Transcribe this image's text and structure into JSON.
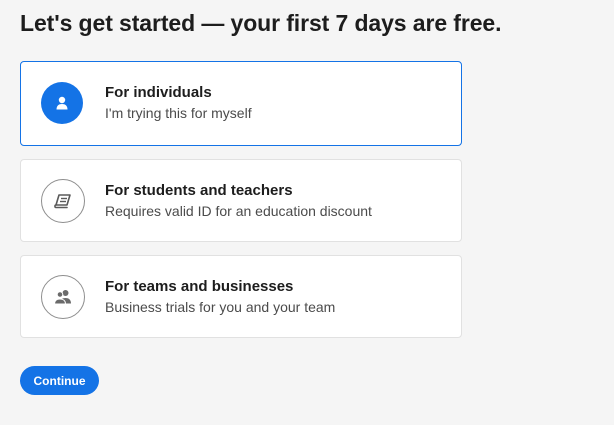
{
  "page": {
    "title": "Let's get started — your first 7 days are free."
  },
  "options": [
    {
      "title": "For individuals",
      "description": "I'm trying this for myself",
      "icon": "person-icon",
      "selected": true
    },
    {
      "title": "For students and teachers",
      "description": "Requires valid ID for an education discount",
      "icon": "book-icon",
      "selected": false
    },
    {
      "title": "For teams and businesses",
      "description": "Business trials for you and your team",
      "icon": "team-icon",
      "selected": false
    }
  ],
  "actions": {
    "continue_label": "Continue"
  },
  "colors": {
    "accent": "#1473e6",
    "background": "#f5f5f5",
    "card": "#ffffff",
    "card_border": "#e1e1e1",
    "icon_outline": "#8e8e8e"
  }
}
